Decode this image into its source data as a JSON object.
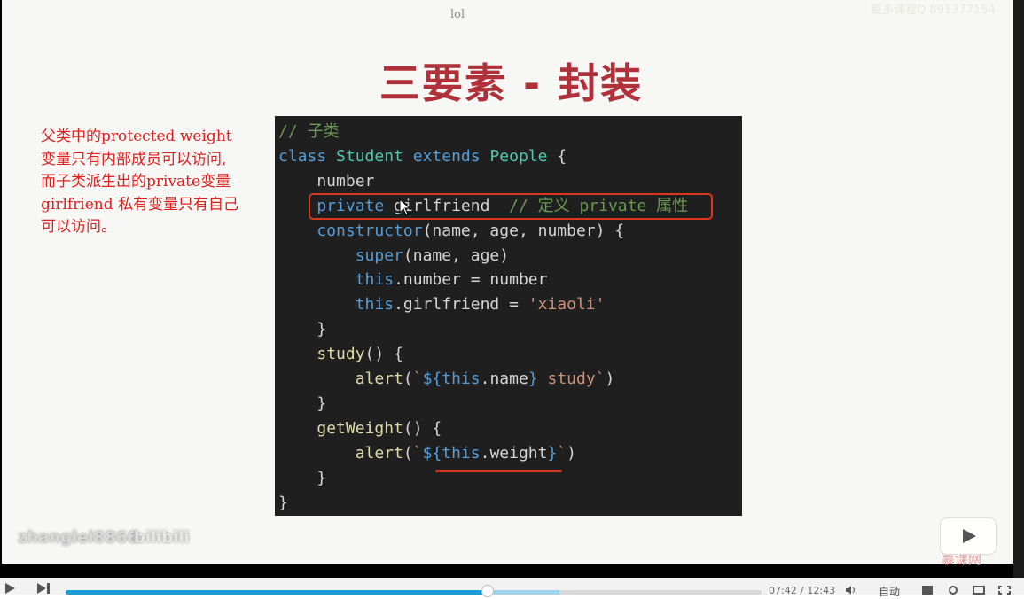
{
  "header": {
    "label": "lol",
    "watermark": "更多课程Q  891377154"
  },
  "slide": {
    "title": "三要素 - 封装",
    "note_lines": [
      "父类中的protected weight",
      "变量只有内部成员可以访问,",
      "而子类派生出的private变量",
      "girlfriend 私有变量只有自己",
      "可以访问。"
    ],
    "code": {
      "comment_line": "// 子类",
      "class_kw": "class",
      "class_name": "Student",
      "extends_kw": "extends",
      "parent_name": "People",
      "open_brace": " {",
      "field_number": "    number",
      "private_kw": "private",
      "private_field": " girlfriend",
      "private_comment": "  // 定义 private 属性",
      "ctor_name": "constructor",
      "ctor_params": "(name, age, number) {",
      "super_kw": "super",
      "super_args": "(name, age)",
      "this_kw_1": "this",
      "assign_number": ".number = number",
      "this_kw_2": "this",
      "assign_gf": ".girlfriend = ",
      "gf_value": "'xiaoli'",
      "close_ctor": "    }",
      "study_name": "study",
      "study_sig": "() {",
      "alert_1": "alert",
      "alert_1_open": "(",
      "tpl_1_a": "`",
      "tpl_1_interp_open": "${",
      "tpl_1_this": "this",
      "tpl_1_prop": ".name",
      "tpl_1_interp_close": "}",
      "tpl_1_rest": " study`",
      "alert_1_close": ")",
      "close_study": "    }",
      "getweight_name": "getWeight",
      "getweight_sig": "() {",
      "alert_2": "alert",
      "alert_2_open": "(",
      "tpl_2_a": "`",
      "tpl_2_interp_open": "${",
      "tpl_2_this": "this",
      "tpl_2_prop": ".weight",
      "tpl_2_interp_close": "}",
      "tpl_2_b": "`",
      "alert_2_close": ")",
      "close_getweight": "    }",
      "close_class": "}"
    }
  },
  "video": {
    "uploader": "zhanglei8866",
    "platform_logo": "bilibili",
    "site_mark": "慕课网",
    "controls": {
      "current_time": "07:42",
      "separator": "/",
      "duration": "12:43",
      "quality": "自动",
      "progress_fraction": 0.607,
      "buffer_fraction": 0.709
    }
  },
  "colors": {
    "title": "#b0313a",
    "note": "#e0201e",
    "highlight": "#d9371f",
    "progress": "#1d9bd8"
  }
}
